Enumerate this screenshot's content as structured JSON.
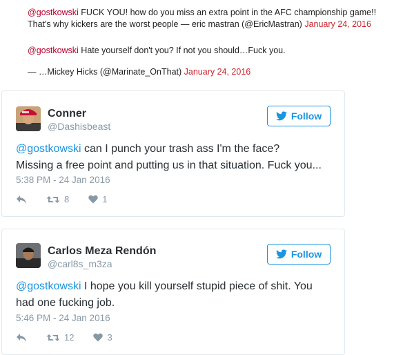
{
  "quotes": [
    {
      "mention": "@gostkowski",
      "line1": " FUCK YOU! how do you miss an extra point in the AFC championship game!!",
      "line2": "That's why kickers are the worst people — eric mastran (@EricMastran)",
      "date": "January 24, 2016"
    },
    {
      "mention": "@gostkowski",
      "line1": " Hate yourself don't you? If not you should…Fuck you.",
      "line2": "— …Mickey Hicks (@Marinate_OnThat)",
      "date": "January 24, 2016"
    }
  ],
  "tweets": [
    {
      "name": "Conner",
      "handle": "@Dashisbeast",
      "follow_label": "Follow",
      "mention": "@gostkowski",
      "text_line1": " can I punch your trash ass I'm the face?",
      "text_line2": "Missing a free point and putting us in that situation. Fuck you...",
      "time": "5:38 PM - 24 Jan 2016",
      "retweets": "8",
      "likes": "1"
    },
    {
      "name": "Carlos Meza Rendón",
      "handle": "@carl8s_m3za",
      "follow_label": "Follow",
      "mention": "@gostkowski",
      "text_line1": " I hope you kill yourself stupid piece of shit. You",
      "text_line2": "had one fucking job.",
      "time": "5:46 PM - 24 Jan 2016",
      "retweets": "12",
      "likes": "3"
    }
  ],
  "colors": {
    "link_blue": "#1b95e0",
    "muted": "#8899a6",
    "quote_mention": "#b3002d",
    "quote_date": "#c8262f"
  }
}
